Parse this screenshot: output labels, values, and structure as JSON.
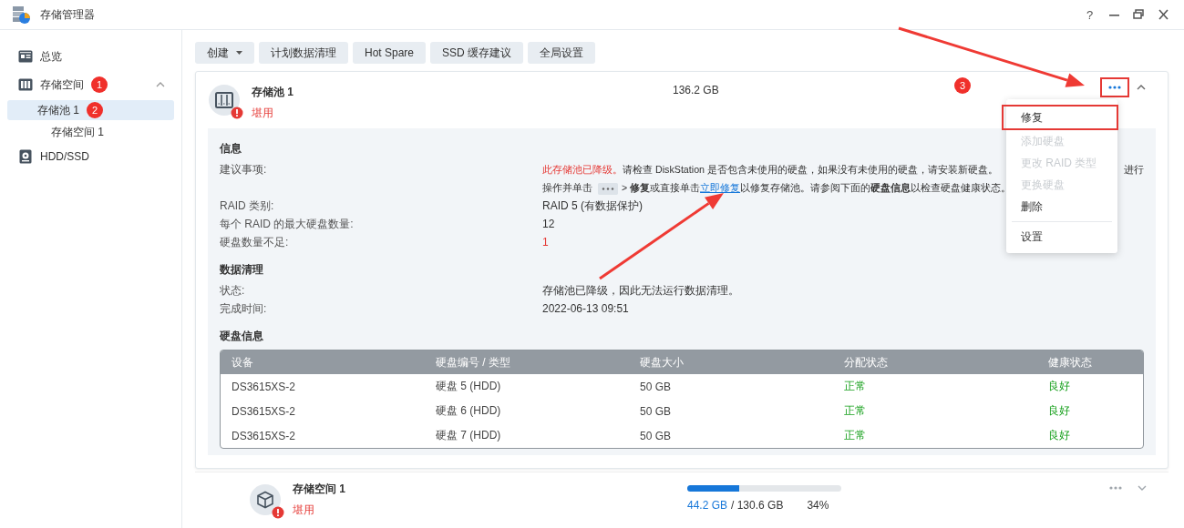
{
  "window": {
    "title": "存储管理器",
    "help": "?"
  },
  "sidebar": {
    "items": [
      {
        "label": "总览",
        "selected": false
      },
      {
        "label": "存储空间",
        "selected": false,
        "expanded": true,
        "annotation": "1",
        "children": [
          {
            "label": "存储池 1",
            "selected": true,
            "annotation": "2",
            "children": [
              {
                "label": "存储空间 1",
                "selected": false
              }
            ]
          }
        ]
      },
      {
        "label": "HDD/SSD",
        "selected": false
      }
    ]
  },
  "toolbar": [
    {
      "label": "创建",
      "kind": "dropdown"
    },
    {
      "label": "计划数据清理",
      "kind": "button"
    },
    {
      "label": "Hot Spare",
      "kind": "button"
    },
    {
      "label": "SSD 缓存建议",
      "kind": "button"
    },
    {
      "label": "全局设置",
      "kind": "button"
    }
  ],
  "pool": {
    "name": "存储池 1",
    "status": "堪用",
    "size": "136.2 GB",
    "annotation": "3",
    "more_highlighted": true,
    "expanded": true,
    "menu": [
      {
        "label": "修复",
        "disabled": false,
        "highlighted": true
      },
      {
        "label": "添加硬盘",
        "disabled": true,
        "highlighted": false
      },
      {
        "label": "更改 RAID 类型",
        "disabled": true,
        "highlighted": false
      },
      {
        "label": "更换硬盘",
        "disabled": true,
        "highlighted": false
      },
      {
        "label": "删除",
        "disabled": false,
        "highlighted": false
      },
      {
        "label": "设置",
        "disabled": false,
        "highlighted": false,
        "divider_before": true
      }
    ],
    "info": {
      "title": "信息",
      "advice": {
        "label": "建议事项:",
        "alert": "此存储池已降级。",
        "line1": "请检查 DiskStation 是否包含未使用的硬盘，如果没有未使用的硬盘，请安装新硬盘。",
        "line1_end": "进行",
        "line2_start": "操作并单击",
        "line2_mid": "> **修复**或直接单击",
        "link": "立即修复",
        "line2_end": "以修复存储池。请参阅下面的**硬盘信息**以检查硬盘健康状态。"
      },
      "rows": [
        {
          "label": "RAID 类别:",
          "value": "RAID 5 (有数据保护)",
          "kind": "text"
        },
        {
          "label": "每个 RAID 的最大硬盘数量:",
          "value": "12",
          "kind": "text"
        },
        {
          "label": "硬盘数量不足:",
          "value": "1",
          "kind": "alert"
        }
      ]
    },
    "scrub": {
      "title": "数据清理",
      "rows": [
        {
          "label": "状态:",
          "value": "存储池已降级，因此无法运行数据清理。"
        },
        {
          "label": "完成时间:",
          "value": "2022-06-13 09:51"
        }
      ]
    },
    "disks": {
      "title": "硬盘信息",
      "columns": [
        "设备",
        "硬盘编号 / 类型",
        "硬盘大小",
        "分配状态",
        "健康状态"
      ],
      "rows": [
        [
          "DS3615XS-2",
          "硬盘 5 (HDD)",
          "50 GB",
          "正常",
          "良好"
        ],
        [
          "DS3615XS-2",
          "硬盘 6 (HDD)",
          "50 GB",
          "正常",
          "良好"
        ],
        [
          "DS3615XS-2",
          "硬盘 7 (HDD)",
          "50 GB",
          "正常",
          "良好"
        ]
      ]
    }
  },
  "volume": {
    "name": "存储空间 1",
    "status": "堪用",
    "used": "44.2 GB",
    "total": "/ 130.6 GB",
    "percent": "34%",
    "level": 0.34,
    "expanded": false
  }
}
